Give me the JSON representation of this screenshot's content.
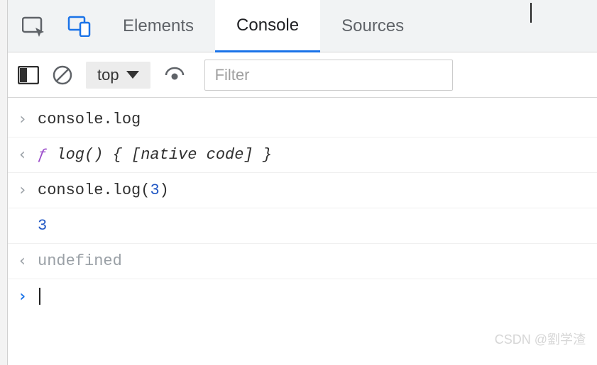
{
  "tabs": {
    "elements": "Elements",
    "console": "Console",
    "sources": "Sources"
  },
  "subbar": {
    "context": "top",
    "filter_placeholder": "Filter"
  },
  "lines": {
    "entry1": "console.log",
    "result1_f": "ƒ",
    "result1_rest": " log() { [native code] }",
    "entry2_pre": "console.log(",
    "entry2_arg": "3",
    "entry2_post": ")",
    "output2": "3",
    "result2": "undefined"
  },
  "watermark": "CSDN @劉学渣"
}
